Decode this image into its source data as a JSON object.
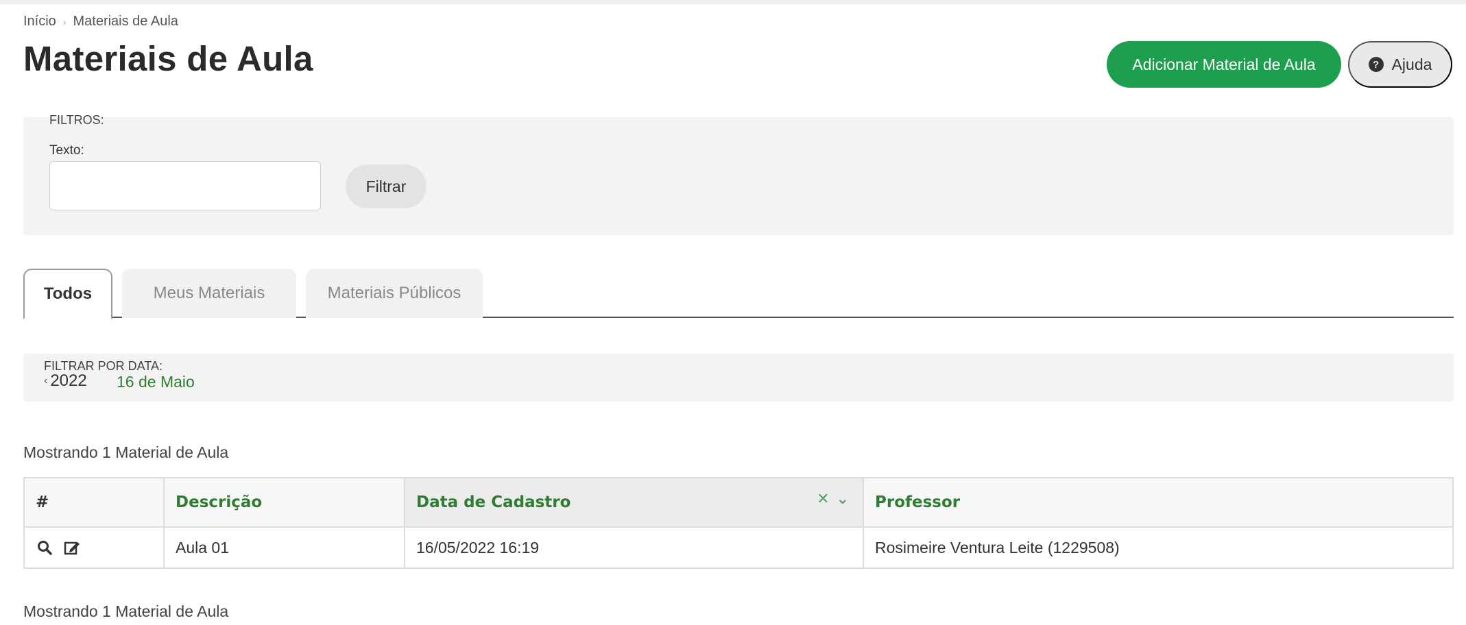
{
  "breadcrumb": {
    "home": "Início",
    "separator": "›",
    "current": "Materiais de Aula"
  },
  "page": {
    "title": "Materiais de Aula"
  },
  "actions": {
    "add_label": "Adicionar Material de Aula",
    "help_label": "Ajuda",
    "help_icon": "question-circle-icon"
  },
  "filters": {
    "title": "FILTROS:",
    "text_label": "Texto:",
    "text_value": "",
    "filter_button": "Filtrar"
  },
  "tabs": [
    {
      "label": "Todos",
      "active": true
    },
    {
      "label": "Meus Materiais",
      "active": false
    },
    {
      "label": "Materiais Públicos",
      "active": false
    }
  ],
  "date_filter": {
    "title": "FILTRAR POR DATA:",
    "year": "2022",
    "day": "16 de Maio"
  },
  "results": {
    "showing_text": "Mostrando 1 Material de Aula"
  },
  "table": {
    "headers": [
      "#",
      "Descrição",
      "Data de Cadastro",
      "Professor"
    ],
    "rows": [
      {
        "description": "Aula 01",
        "date": "16/05/2022 16:19",
        "teacher": "Rosimeire Ventura Leite (1229508)"
      }
    ]
  },
  "colors": {
    "accent_green": "#1e9e4f",
    "header_text_green": "#2e7d32"
  }
}
